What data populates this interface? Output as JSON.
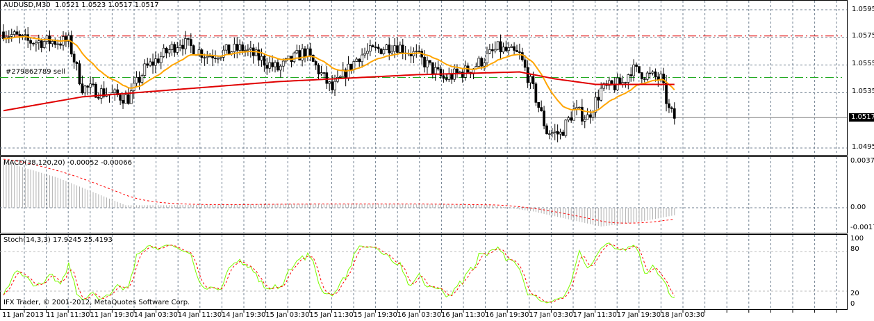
{
  "header": {
    "symbol": "AUDUSD,M30",
    "ohlc": "1.0521 1.0523 1.0517 1.0517"
  },
  "order_label": "#279862789 sell",
  "current_price": "1.0517",
  "price_axis": [
    "1.0595",
    "1.0575",
    "1.0555",
    "1.0535",
    "1.0495"
  ],
  "macd": {
    "label": "MACD(38,120,20) -0.00052 -0.00066",
    "axis": [
      "0.00372",
      "0.00",
      "-0.00172"
    ]
  },
  "stoch": {
    "label": "Stoch(14,3,3) 17.9245 25.4193",
    "axis": [
      "100",
      "80",
      "20",
      "0"
    ]
  },
  "copyright": "IFX Trader, © 2001-2012, MetaQuotes Software Corp.",
  "time_axis": [
    "11 Jan 2013",
    "11 Jan 11:30",
    "11 Jan 19:30",
    "14 Jan 03:30",
    "14 Jan 11:30",
    "14 Jan 19:30",
    "15 Jan 03:30",
    "15 Jan 11:30",
    "15 Jan 19:30",
    "16 Jan 03:30",
    "16 Jan 11:30",
    "16 Jan 19:30",
    "17 Jan 03:30",
    "17 Jan 11:30",
    "17 Jan 19:30",
    "18 Jan 03:30"
  ],
  "colors": {
    "bull_candle": "#ffffff",
    "bear_candle": "#000000",
    "ma_fast": "#ffa500",
    "ma_slow": "#e00000",
    "stop_line": "#e00000",
    "take_line": "#22aa22",
    "stoch_main": "#7cfc00",
    "stoch_signal": "#ff0000",
    "macd_hist": "#b0b0b0",
    "grid": "#708090"
  },
  "chart_data": {
    "type": "candlestick",
    "bars": 248,
    "price_keypoints": [
      [
        0,
        1.0579
      ],
      [
        9,
        1.0572
      ],
      [
        24,
        1.0572
      ],
      [
        29,
        1.0539
      ],
      [
        39,
        1.0534
      ],
      [
        46,
        1.0531
      ],
      [
        52,
        1.0552
      ],
      [
        65,
        1.0572
      ],
      [
        75,
        1.0562
      ],
      [
        88,
        1.0567
      ],
      [
        101,
        1.0552
      ],
      [
        111,
        1.0565
      ],
      [
        121,
        1.0537
      ],
      [
        131,
        1.0562
      ],
      [
        144,
        1.057
      ],
      [
        152,
        1.0562
      ],
      [
        162,
        1.0545
      ],
      [
        172,
        1.0552
      ],
      [
        182,
        1.0567
      ],
      [
        190,
        1.0562
      ],
      [
        195,
        1.0537
      ],
      [
        200,
        1.0507
      ],
      [
        205,
        1.0505
      ],
      [
        210,
        1.0522
      ],
      [
        215,
        1.0517
      ],
      [
        220,
        1.0537
      ],
      [
        228,
        1.0542
      ],
      [
        231,
        1.0552
      ],
      [
        238,
        1.0547
      ],
      [
        242,
        1.0545
      ],
      [
        245,
        1.0522
      ],
      [
        247,
        1.0517
      ]
    ],
    "slow_ma_keypoints": [
      [
        0,
        1.0522
      ],
      [
        29,
        1.0532
      ],
      [
        75,
        1.0539
      ],
      [
        101,
        1.0543
      ],
      [
        152,
        1.0548
      ],
      [
        190,
        1.055
      ],
      [
        203,
        1.0545
      ],
      [
        218,
        1.0541
      ],
      [
        247,
        1.0541
      ]
    ],
    "macd_keypoints": [
      [
        0,
        0.0037
      ],
      [
        20,
        0.0024
      ],
      [
        45,
        0.0002
      ],
      [
        60,
        0.0002
      ],
      [
        100,
        0.0003
      ],
      [
        150,
        0.0003
      ],
      [
        180,
        0.0002
      ],
      [
        195,
        -0.0003
      ],
      [
        220,
        -0.0015
      ],
      [
        235,
        -0.0011
      ],
      [
        247,
        -0.0006
      ]
    ],
    "stop_price": 1.0576,
    "take_price": 1.0546
  }
}
